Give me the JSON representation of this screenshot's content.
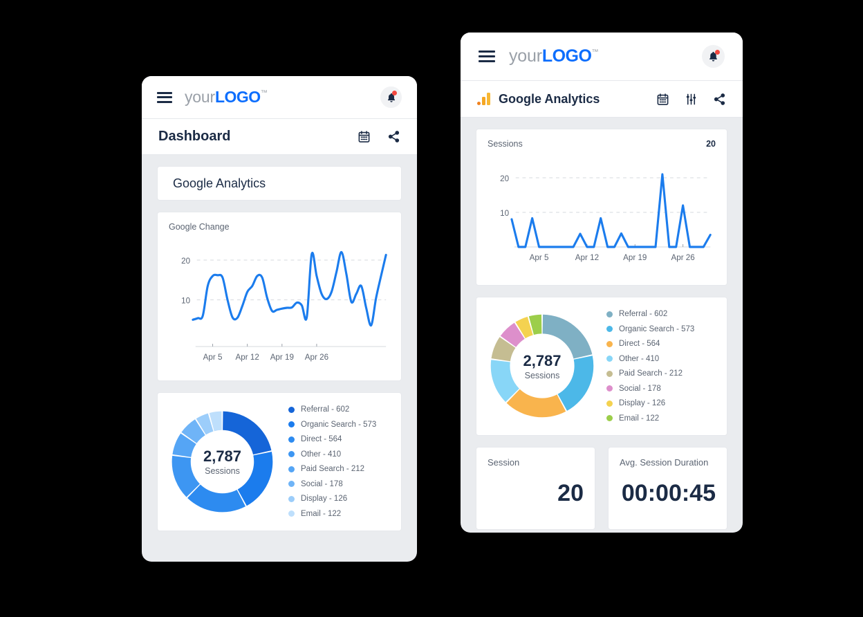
{
  "theme": {
    "page_bg": "#000000",
    "panel_bg": "#eaecef",
    "card_bg": "#ffffff",
    "accent_blue": "#0d6efd",
    "line_blue": "#1b7ced",
    "text_dark": "#1b2b45",
    "text_muted": "#5b6472",
    "alert_red": "#f4473f"
  },
  "logo": {
    "your": "your",
    "brand": "LOGO",
    "tm": "™",
    "menu_icon": "hamburger-menu-icon",
    "bell_icon": "notification-bell-icon"
  },
  "left_panel": {
    "subbar": {
      "title": "Dashboard",
      "icons": [
        "calendar-icon",
        "share-icon"
      ]
    },
    "section_card": {
      "title": "Google Analytics"
    },
    "line_chart": {
      "label": "Google Change"
    },
    "donut": {
      "value": "2,787",
      "sub": "Sessions"
    }
  },
  "right_panel": {
    "subbar": {
      "title": "Google Analytics",
      "brand_icon": "google-analytics-icon",
      "icons": [
        "calendar-icon",
        "sliders-filter-icon",
        "share-icon"
      ]
    },
    "line_chart": {
      "label": "Sessions",
      "value": "20"
    },
    "donut": {
      "value": "2,787",
      "sub": "Sessions"
    },
    "stat_cards": [
      {
        "label": "Session",
        "value": "20"
      },
      {
        "label": "Avg. Session Duration",
        "value": "00:00:45"
      }
    ]
  },
  "chart_data": [
    {
      "type": "line",
      "id": "left-google-change",
      "title": "Google Change",
      "xlabel": "",
      "ylabel": "",
      "ylim": [
        0,
        24
      ],
      "grid": true,
      "yticks": [
        10,
        20
      ],
      "xticks": [
        "Apr 5",
        "Apr 12",
        "Apr 19",
        "Apr 26"
      ],
      "xtick_index": [
        4,
        11,
        18,
        25
      ],
      "series": [
        {
          "name": "Google Change",
          "color": "#1b7ced",
          "values": [
            5,
            5.4,
            6,
            13.5,
            16,
            16.2,
            15.6,
            10,
            5.6,
            5.5,
            8.5,
            12,
            13.5,
            16,
            15.6,
            10.5,
            7.2,
            7.5,
            7.8,
            8,
            8.1,
            9.3,
            8.6,
            5.6,
            21.5,
            16,
            11.5,
            10.2,
            12,
            17,
            22,
            16.5,
            9.5,
            11.5,
            13.5,
            8,
            3.6,
            10.5,
            16,
            21.3
          ]
        }
      ]
    },
    {
      "type": "pie",
      "id": "left-sessions-donut",
      "title": "Sessions",
      "center_value": "2,787",
      "center_sub": "Sessions",
      "donut": true,
      "labels": [
        "Referral",
        "Organic Search",
        "Direct",
        "Other",
        "Paid Search",
        "Social",
        "Display",
        "Email"
      ],
      "values": [
        602,
        573,
        564,
        410,
        212,
        178,
        126,
        122
      ],
      "colors": [
        "#1565d8",
        "#1b7ced",
        "#2d8bf0",
        "#3d96f2",
        "#55a5f5",
        "#6fb4f7",
        "#9ccdfa",
        "#bedffc"
      ],
      "legend_position": "right",
      "legend": [
        "Referral - 602",
        "Organic Search - 573",
        "Direct - 564",
        "Other - 410",
        "Paid Search - 212",
        "Social - 178",
        "Display - 126",
        "Email - 122"
      ]
    },
    {
      "type": "line",
      "id": "right-sessions",
      "title": "Sessions",
      "value_badge": "20",
      "xlabel": "",
      "ylabel": "",
      "ylim": [
        0,
        24
      ],
      "grid": true,
      "yticks": [
        10,
        20
      ],
      "xticks": [
        "Apr 5",
        "Apr 12",
        "Apr 19",
        "Apr 26"
      ],
      "xtick_index": [
        4,
        11,
        18,
        25
      ],
      "series": [
        {
          "name": "Sessions",
          "color": "#1b7ced",
          "values": [
            8,
            0,
            0,
            8.3,
            0,
            0,
            0,
            0,
            0,
            0,
            3.8,
            0,
            0,
            8.3,
            0,
            0,
            3.9,
            0,
            0,
            0,
            0,
            0,
            21,
            0,
            0,
            12,
            0,
            0,
            0,
            3.5
          ]
        }
      ]
    },
    {
      "type": "pie",
      "id": "right-sessions-donut",
      "title": "Sessions",
      "center_value": "2,787",
      "center_sub": "Sessions",
      "donut": true,
      "labels": [
        "Referral",
        "Organic Search",
        "Direct",
        "Other",
        "Paid Search",
        "Social",
        "Display",
        "Email"
      ],
      "values": [
        602,
        573,
        564,
        410,
        212,
        178,
        126,
        122
      ],
      "colors": [
        "#7fb0c4",
        "#4cb8e8",
        "#f9b44d",
        "#88d6f7",
        "#c5bd92",
        "#dd8fcb",
        "#f4d250",
        "#9cce4a"
      ],
      "legend_position": "right",
      "legend": [
        "Referral - 602",
        "Organic Search - 573",
        "Direct - 564",
        "Other - 410",
        "Paid Search - 212",
        "Social - 178",
        "Display - 126",
        "Email - 122"
      ]
    }
  ]
}
